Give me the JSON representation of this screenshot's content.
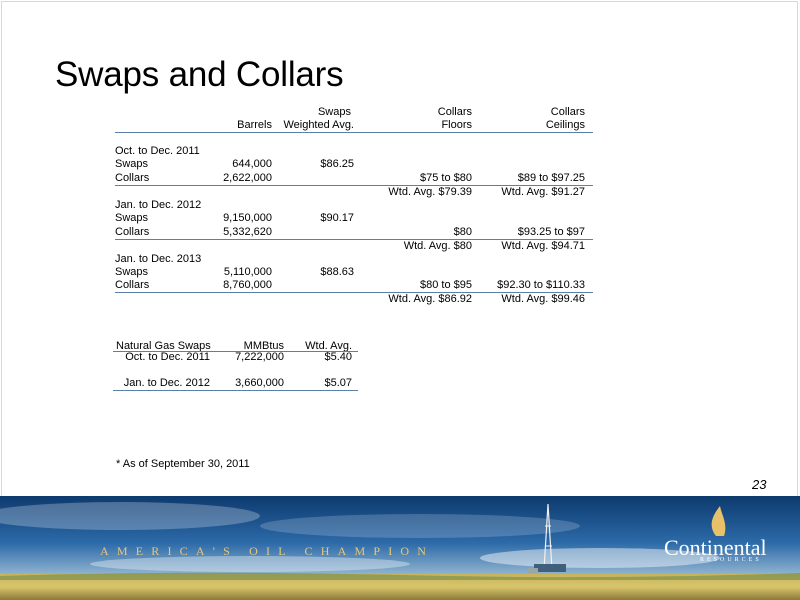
{
  "title": "Swaps and Collars",
  "oil_table": {
    "headers": {
      "barrels": "Barrels",
      "swaps_line1": "Swaps",
      "swaps_line2": "Weighted Avg.",
      "floors_line1": "Collars",
      "floors_line2": "Floors",
      "ceilings_line1": "Collars",
      "ceilings_line2": "Ceilings"
    },
    "periods": [
      {
        "label": "Oct. to Dec. 2011",
        "swaps": {
          "label": "Swaps",
          "barrels": "644,000",
          "price": "$86.25"
        },
        "collars": {
          "label": "Collars",
          "barrels": "2,622,000",
          "floor": "$75 to $80",
          "ceiling": "$89 to $97.25"
        },
        "wtd_floor": "Wtd. Avg. $79.39",
        "wtd_ceiling": "Wtd. Avg. $91.27"
      },
      {
        "label": "Jan. to Dec. 2012",
        "swaps": {
          "label": "Swaps",
          "barrels": "9,150,000",
          "price": "$90.17"
        },
        "collars": {
          "label": "Collars",
          "barrels": "5,332,620",
          "floor": "$80",
          "ceiling": "$93.25 to $97"
        },
        "wtd_floor": "Wtd. Avg. $80",
        "wtd_ceiling": "Wtd. Avg. $94.71"
      },
      {
        "label": "Jan. to Dec. 2013",
        "swaps": {
          "label": "Swaps",
          "barrels": "5,110,000",
          "price": "$88.63"
        },
        "collars": {
          "label": "Collars",
          "barrels": "8,760,000",
          "floor": "$80 to $95",
          "ceiling": "$92.30 to $110.33"
        },
        "wtd_floor": "Wtd. Avg. $86.92",
        "wtd_ceiling": "Wtd. Avg. $99.46"
      }
    ]
  },
  "gas_table": {
    "headers": [
      "Natural Gas Swaps",
      "MMBtus",
      "Wtd. Avg."
    ],
    "rows": [
      {
        "period": "Oct. to Dec. 2011",
        "mmbtus": "7,222,000",
        "avg": "$5.40"
      },
      {
        "period": "Jan. to Dec. 2012",
        "mmbtus": "3,660,000",
        "avg": "$5.07"
      }
    ]
  },
  "footnote": "* As of September 30, 2011",
  "page_number": "23",
  "banner": {
    "tagline": "AMERICA'S OIL CHAMPION",
    "logo": "Continental",
    "logo_sub": "RESOURCES"
  }
}
